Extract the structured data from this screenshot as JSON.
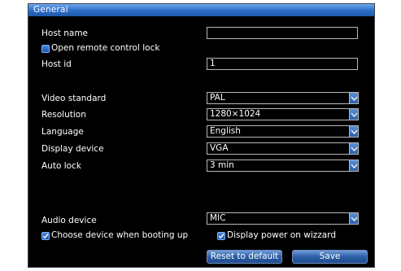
{
  "window": {
    "title": "General"
  },
  "fields": {
    "host_name": {
      "label": "Host name",
      "value": ""
    },
    "remote_lock": {
      "label": "Open remote control lock",
      "checked": false
    },
    "host_id": {
      "label": "Host id",
      "value": "1"
    },
    "video_standard": {
      "label": "Video standard",
      "value": "PAL"
    },
    "resolution": {
      "label": "Resolution",
      "value": "1280×1024"
    },
    "language": {
      "label": "Language",
      "value": "English"
    },
    "display_device": {
      "label": "Display device",
      "value": "VGA"
    },
    "auto_lock": {
      "label": "Auto lock",
      "value": "3 min"
    },
    "audio_device": {
      "label": "Audio device",
      "value": "MIC"
    },
    "choose_device": {
      "label": "Choose device when booting up",
      "checked": true
    },
    "display_wizard": {
      "label": "Display power on wizzard",
      "checked": true
    }
  },
  "buttons": {
    "reset": "Reset to default",
    "save": "Save"
  },
  "colors": {
    "titlebar": "#2e6fc8",
    "background": "#000000",
    "border": "#b8b8b8"
  }
}
